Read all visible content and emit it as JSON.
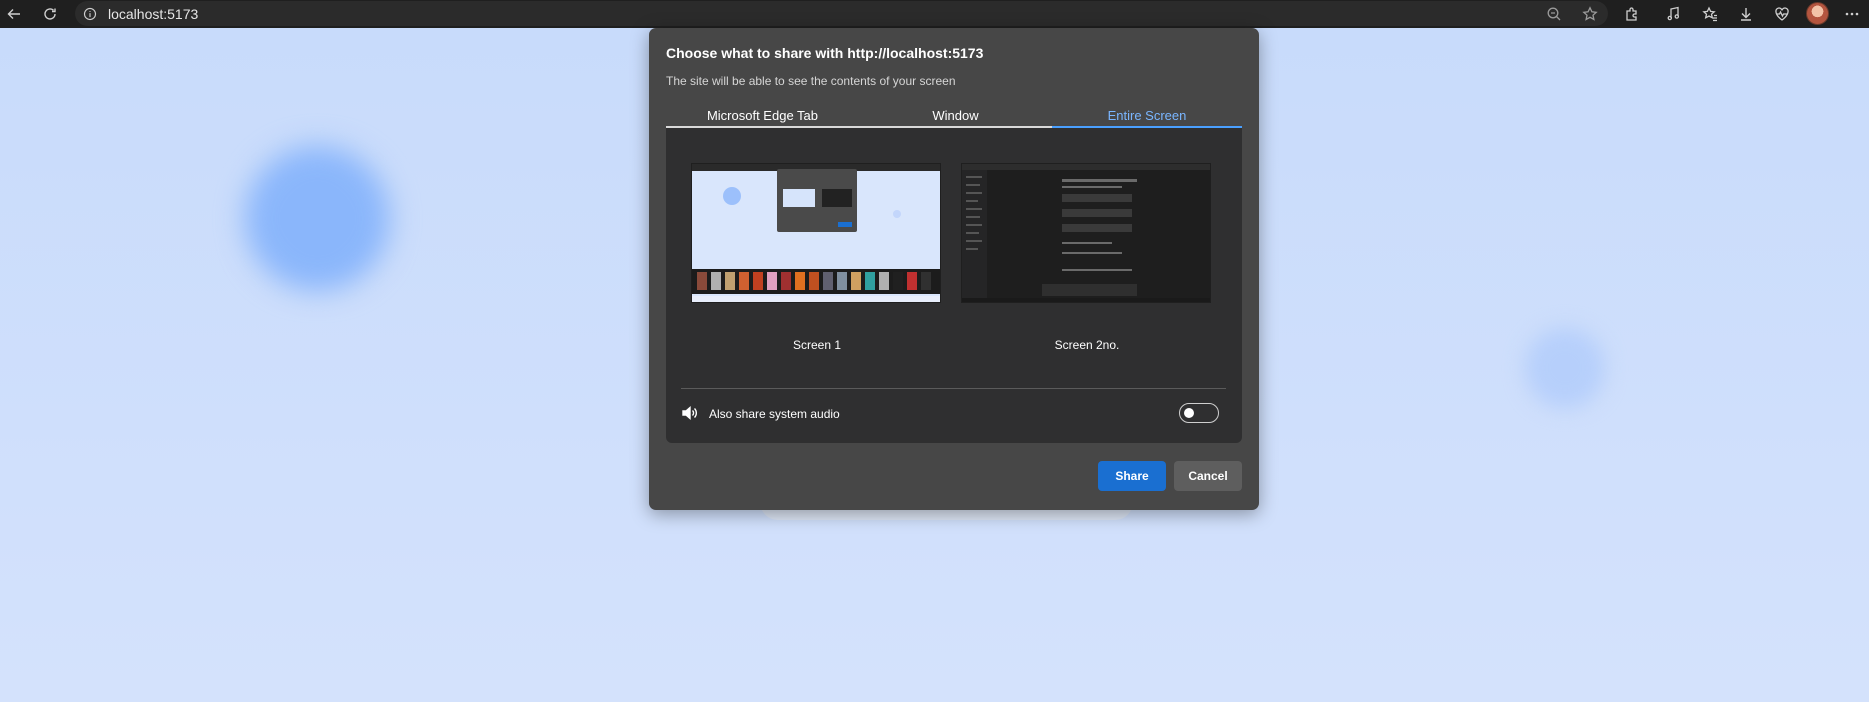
{
  "browser": {
    "url": "localhost:5173"
  },
  "dialog": {
    "title": "Choose what to share with http://localhost:5173",
    "subtitle": "The site will be able to see the contents of your screen",
    "tabs": [
      {
        "label": "Microsoft Edge Tab",
        "active": false
      },
      {
        "label": "Window",
        "active": false
      },
      {
        "label": "Entire Screen",
        "active": true
      }
    ],
    "screens": [
      {
        "label": "Screen 1"
      },
      {
        "label": "Screen 2no."
      }
    ],
    "audio": {
      "label": "Also share system audio",
      "enabled": false
    },
    "buttons": {
      "share": "Share",
      "cancel": "Cancel"
    }
  },
  "colors": {
    "accent": "#1a6fd1",
    "active_tab": "#7ab6ff",
    "dialog_bg": "#474747",
    "panel_bg": "#2f2f30"
  },
  "icons": {
    "toolbar": [
      "back-arrow-icon",
      "refresh-icon",
      "site-info-icon",
      "zoom-out-icon",
      "favorite-star-icon",
      "extensions-icon",
      "media-control-icon",
      "favorites-icon",
      "downloads-icon",
      "browser-essentials-icon",
      "profile-avatar",
      "more-options-icon"
    ],
    "dialog": [
      "speaker-icon"
    ]
  }
}
